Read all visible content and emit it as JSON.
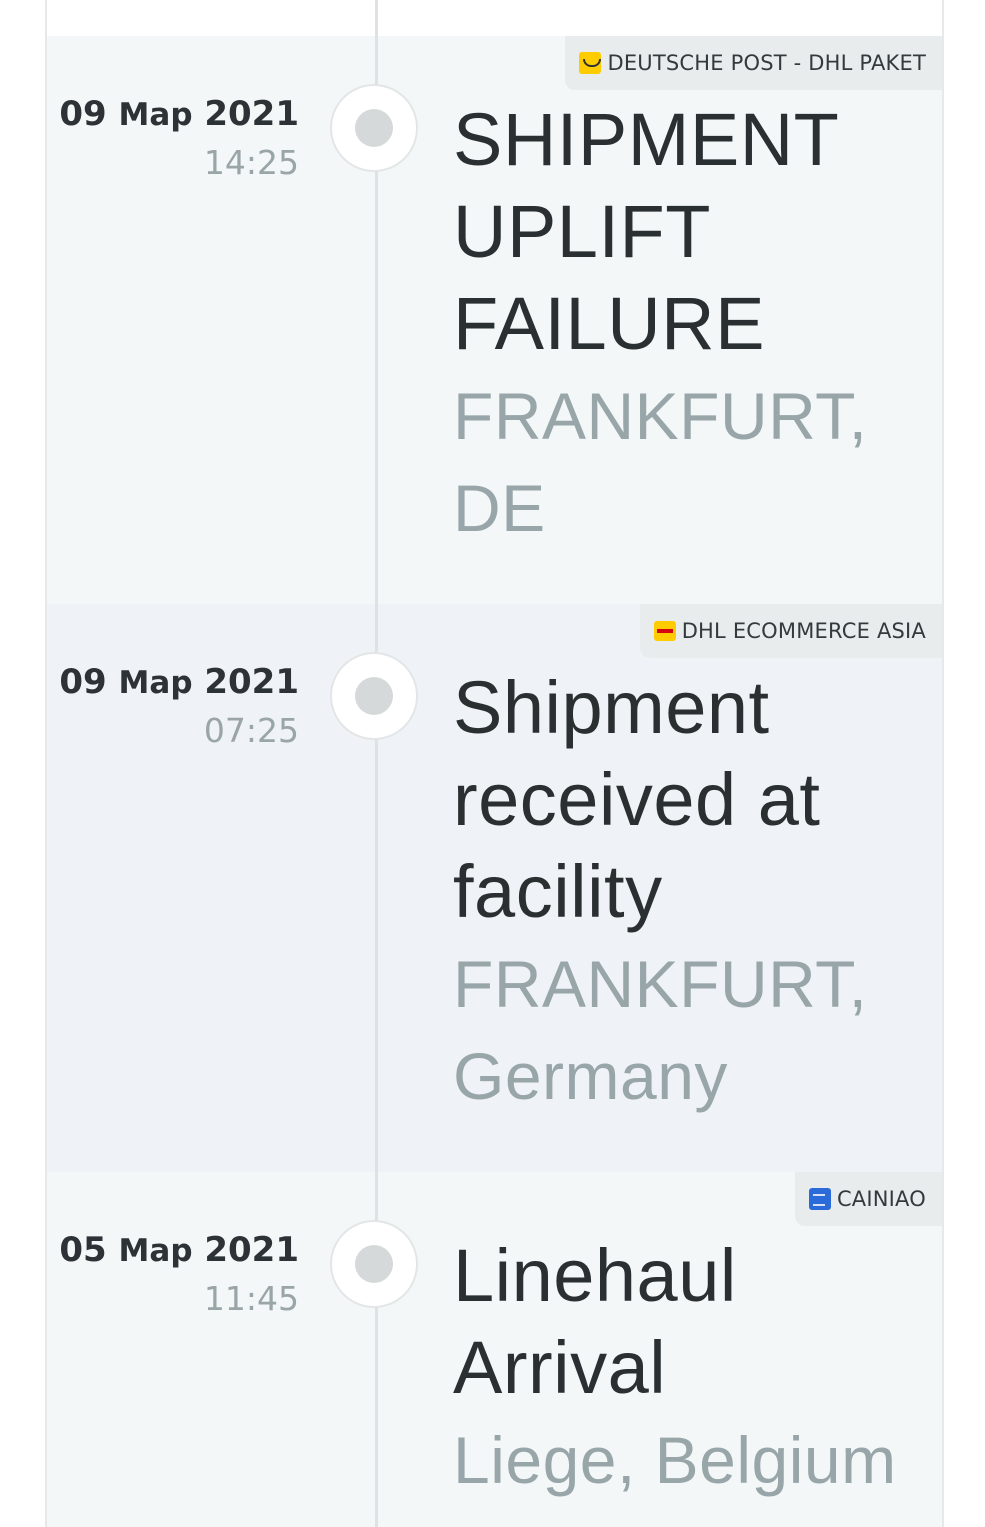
{
  "events": [
    {
      "carrier": "DEUTSCHE POST - DHL PAKET",
      "carrier_icon": "deutsche-post-logo-icon",
      "date_day": "09",
      "date_month": "Map",
      "date_year": "2021",
      "time": "14:25",
      "status_lines": [
        "SHIPMENT",
        "UPLIFT",
        "FAILURE"
      ],
      "location_lines": [
        "FRANKFURT,",
        "DE"
      ]
    },
    {
      "carrier": "DHL ECOMMERCE ASIA",
      "carrier_icon": "dhl-logo-icon",
      "date_day": "09",
      "date_month": "Map",
      "date_year": "2021",
      "time": "07:25",
      "status_lines": [
        "Shipment",
        "received at",
        "facility"
      ],
      "location_lines": [
        "FRANKFURT,",
        "Germany"
      ]
    },
    {
      "carrier": "CAINIAO",
      "carrier_icon": "cainiao-logo-icon",
      "date_day": "05",
      "date_month": "Map",
      "date_year": "2021",
      "time": "11:45",
      "status_lines": [
        "Linehaul",
        "Arrival"
      ],
      "location_lines": [
        "Liege, Belgium"
      ]
    }
  ],
  "colors": {
    "event_bg_a": "#f3f7f8",
    "event_bg_b": "#eff2f6",
    "status_text": "#2a2f31",
    "location_text": "#98a6a9",
    "dhl_yellow": "#ffcc00",
    "dhl_red": "#d40511",
    "cainiao_blue": "#2a6ad9"
  }
}
